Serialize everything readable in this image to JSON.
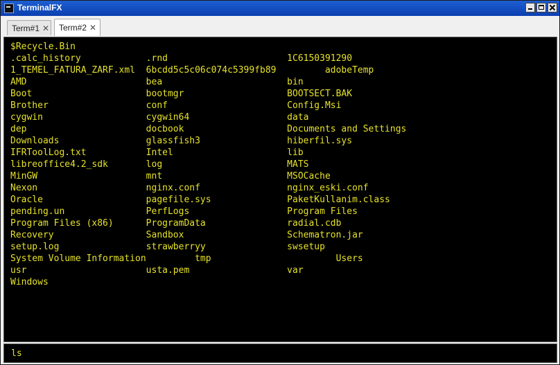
{
  "window": {
    "title": "TerminalFX",
    "controls": {
      "minimize": "minimize-icon",
      "maximize": "maximize-icon",
      "close": "close-icon"
    }
  },
  "tabs": [
    {
      "label": "Term#1",
      "active": false
    },
    {
      "label": "Term#2",
      "active": true
    }
  ],
  "tab_close_glyph": "✕",
  "terminal": {
    "text_color": "#e6e22a",
    "background": "#000000",
    "lines": [
      "$Recycle.Bin",
      ".calc_history            .rnd                      1C6150391290",
      "1_TEMEL_FATURA_ZARF.xml  6bcdd5c5c06c074c5399fb89         adobeTemp",
      "AMD                      bea                       bin",
      "Boot                     bootmgr                   BOOTSECT.BAK",
      "Brother                  conf                      Config.Msi",
      "cygwin                   cygwin64                  data",
      "dep                      docbook                   Documents and Settings",
      "Downloads                glassfish3                hiberfil.sys",
      "IFRToolLog.txt           Intel                     lib",
      "libreoffice4.2_sdk       log                       MATS",
      "MinGW                    mnt                       MSOCache",
      "Nexon                    nginx.conf                nginx_eski.conf",
      "Oracle                   pagefile.sys              PaketKullanim.class",
      "pending.un               PerfLogs                  Program Files",
      "Program Files (x86)      ProgramData               radial.cdb",
      "Recovery                 Sandbox                   Schematron.jar",
      "setup.log                strawberryy               swsetup",
      "System Volume Information         tmp                       Users",
      "usr                      usta.pem                  var",
      "Windows"
    ]
  },
  "command_input": {
    "value": "ls"
  }
}
